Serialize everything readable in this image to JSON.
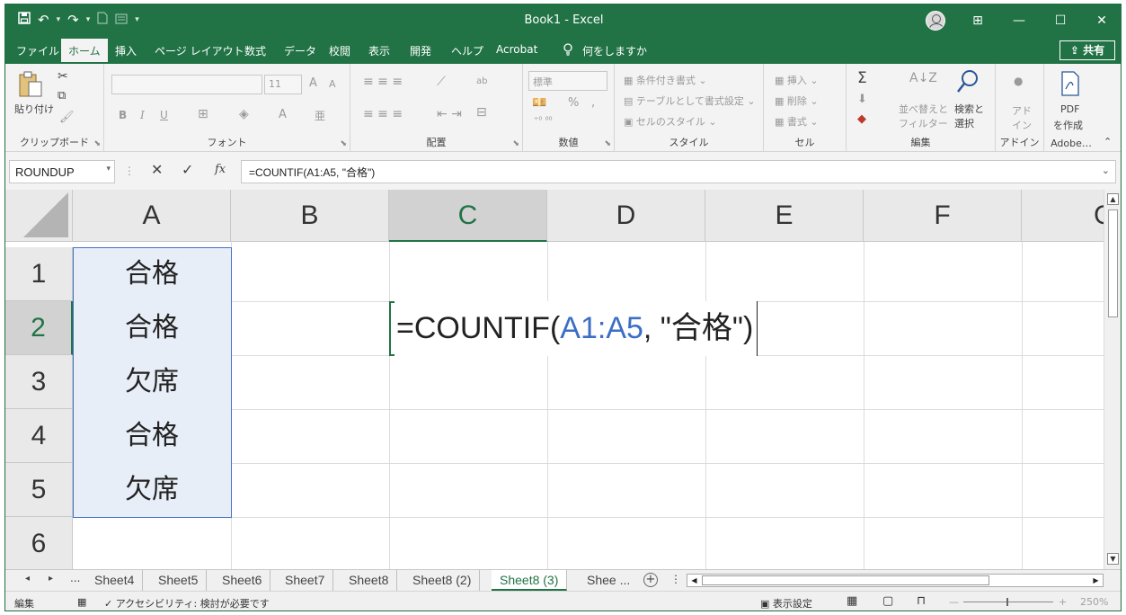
{
  "window": {
    "title": "Book1  -  Excel",
    "controls": {
      "ribbon_display": "⊞",
      "minimize": "—",
      "maximize": "☐",
      "close": "✕"
    }
  },
  "qat": {
    "save": "💾",
    "undo": "↶",
    "redo": "↷",
    "more": "▾"
  },
  "tabs": [
    {
      "label": "ファイル"
    },
    {
      "label": "ホーム",
      "active": true
    },
    {
      "label": "挿入"
    },
    {
      "label": "ページ レイアウト"
    },
    {
      "label": "数式"
    },
    {
      "label": "データ"
    },
    {
      "label": "校閲"
    },
    {
      "label": "表示"
    },
    {
      "label": "開発"
    },
    {
      "label": "ヘルプ"
    },
    {
      "label": "Acrobat"
    }
  ],
  "tell_me": {
    "icon": "lightbulb-icon",
    "label": "何をしますか"
  },
  "share": {
    "label": "共有"
  },
  "ribbon": {
    "clipboard": {
      "paste_label": "貼り付け",
      "group_label": "クリップボード"
    },
    "font": {
      "group_label": "フォント",
      "size": "11",
      "grow": "A",
      "shrink": "A",
      "bold": "B",
      "italic": "I",
      "underline": "U",
      "color": "A",
      "phonetic": "亜"
    },
    "alignment": {
      "group_label": "配置",
      "wrap": "ab"
    },
    "number": {
      "group_label": "数値",
      "format": "標準",
      "percent": "%",
      "comma": ","
    },
    "styles": {
      "group_label": "スタイル",
      "conditional": "条件付き書式",
      "table": "テーブルとして書式設定",
      "cell": "セルのスタイル"
    },
    "cells": {
      "group_label": "セル",
      "insert": "挿入",
      "delete": "削除",
      "format": "書式"
    },
    "editing": {
      "group_label": "編集",
      "sum": "Σ",
      "sort": "並べ替えと\nフィルター",
      "sort_line1": "並べ替えと",
      "sort_line2": "フィルター",
      "find_line1": "検索と",
      "find_line2": "選択"
    },
    "addins": {
      "group_label": "アドイン",
      "line1": "アド",
      "line2": "イン"
    },
    "adobe": {
      "group_label": "Adobe…",
      "line1": "PDF",
      "line2": "を作成"
    }
  },
  "formula_bar": {
    "name_box": "ROUNDUP",
    "cancel": "✕",
    "enter": "✓",
    "fx": "fx",
    "formula": "=COUNTIF(A1:A5, \"合格\")"
  },
  "sheet": {
    "columns": [
      "A",
      "B",
      "C",
      "D",
      "E",
      "F",
      "G"
    ],
    "selected_column": "C",
    "rows": [
      "1",
      "2",
      "3",
      "4",
      "5",
      "6"
    ],
    "selected_row": "2",
    "col_a_values": [
      "合格",
      "合格",
      "欠席",
      "合格",
      "欠席"
    ],
    "editing": {
      "eq": "=COUNTIF(",
      "ref": "A1:A5",
      "rest": ", \"合格\"",
      "close": ")"
    }
  },
  "sheet_tabs": [
    {
      "label": "Sheet4"
    },
    {
      "label": "Sheet5"
    },
    {
      "label": "Sheet6"
    },
    {
      "label": "Sheet7"
    },
    {
      "label": "Sheet8"
    },
    {
      "label": "Sheet8 (2)"
    },
    {
      "label": "Sheet8 (3)",
      "active": true
    },
    {
      "label": "Shee ..."
    }
  ],
  "sheet_nav": {
    "prev": "◂",
    "next": "▸",
    "more": "..."
  },
  "status": {
    "mode": "編集",
    "accessibility": "アクセシビリティ: 検討が必要です",
    "display_settings": "表示設定",
    "zoom_minus": "—",
    "zoom_plus": "+",
    "zoom": "250%"
  }
}
